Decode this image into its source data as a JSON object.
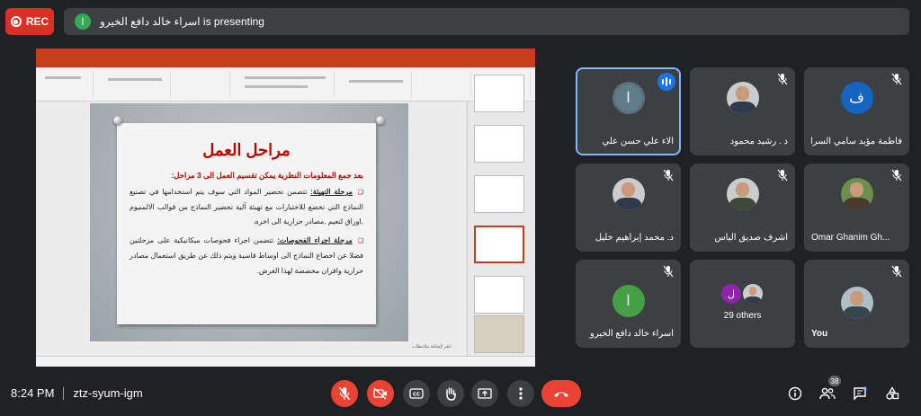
{
  "recording": {
    "label": "REC"
  },
  "presenter_bar": {
    "avatar_letter": "ا",
    "text": "اسراء خالد دافع الخيرو is presenting"
  },
  "slide": {
    "title": "مراحل العمل",
    "subtitle": "بعد جمع المعلومات النظرية يمكن تقسيم العمل الى 3 مراحل:",
    "point1_heading": "مرحلة التهيئة:",
    "point1_text": " تتضمن تحضير المواد التي سوف يتم استخدامها في تصنيع النماذج التي تخضع للاختبارات مع تهيئة آلية تحضير النماذج من قوالب الالمنيوم ,اوراق لتعيم ,مصادر حرارية الى اخره.",
    "point2_heading": "مرحلة اجراء الفحوصات:",
    "point2_text": " تتضمن اجراء فحوصات ميكانيكية على مرحلتين فضلا عن اخضاع النماذج الى اوساط قاسية ويتم ذلك عن طريق استعمال مصادر حرارية وافران مخصصة لهذا الغرض.",
    "notes_hint": "انقر لإضافة ملاحظات"
  },
  "participants": [
    {
      "name": "الاء علي حسن علي",
      "initial": "ا",
      "avatar_color": "#607d8b",
      "speaking": true
    },
    {
      "name": "د . رشيد محمود",
      "photo": true
    },
    {
      "name": "فاطمة مؤيد سامي السراج",
      "initial": "ف",
      "avatar_color": "#1565c0"
    },
    {
      "name": "د. محمد إبراهيم خليل",
      "photo": true
    },
    {
      "name": "اشرف صديق الياس",
      "photo": true
    },
    {
      "name": "Omar Ghanim Gh...",
      "photo": true
    },
    {
      "name": "اسراء خالد دافع الخيرو",
      "initial": "ا",
      "avatar_color": "#43a047"
    },
    {
      "name": "29 others",
      "initial": "ل",
      "avatar_color": "#8e24aa"
    },
    {
      "name": "You",
      "photo": true
    }
  ],
  "footer": {
    "time": "8:24 PM",
    "meeting_code": "ztz-syum-igm",
    "people_count": "38"
  },
  "icons": {
    "mic_off": "mic-off-icon",
    "cam_off": "camera-off-icon",
    "captions": "captions-icon",
    "raise_hand": "raise-hand-icon",
    "present": "present-screen-icon",
    "more": "more-options-icon",
    "hang_up": "hang-up-icon",
    "info": "info-icon",
    "people": "people-icon",
    "chat": "chat-icon",
    "activities": "activities-icon"
  },
  "colors": {
    "rec": "#d93025",
    "hang_up": "#ea4335",
    "ppt_accent": "#c43e1c",
    "speaking_outline": "#8ab4f8"
  }
}
